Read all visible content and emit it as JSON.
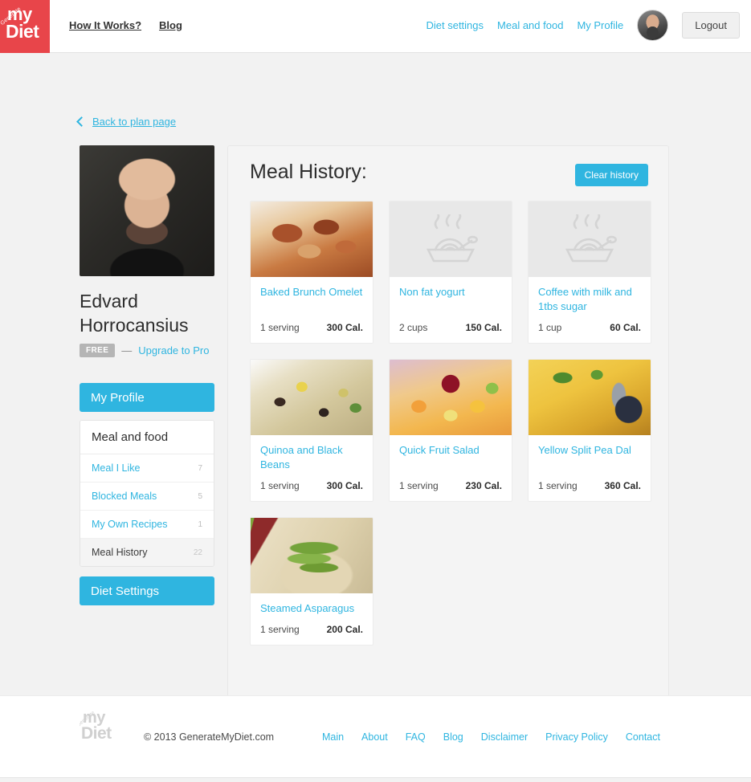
{
  "brand": {
    "logo_my": "my",
    "logo_diet": "Diet",
    "logo_generate": "Generate",
    "accent_blue": "#2fb5e0",
    "logo_red": "#e8454a"
  },
  "header": {
    "nav_left": [
      {
        "label": "How It Works?"
      },
      {
        "label": "Blog"
      }
    ],
    "nav_right": [
      {
        "label": "Diet settings"
      },
      {
        "label": "Meal and food"
      },
      {
        "label": "My Profile"
      }
    ],
    "avatar_icon": "user-avatar-icon",
    "logout_label": "Logout"
  },
  "back_link": {
    "icon": "chevron-left-icon",
    "label": "Back to plan page"
  },
  "sidebar": {
    "photo_icon": "profile-photo",
    "user_name": "Edvard Horrocansius",
    "plan_badge": "FREE",
    "plan_dash": "—",
    "upgrade_label": "Upgrade to Pro",
    "profile_button": "My Profile",
    "menu_heading": "Meal and food",
    "menu_items": [
      {
        "label": "Meal I Like",
        "count": "7",
        "active": false
      },
      {
        "label": "Blocked Meals",
        "count": "5",
        "active": false
      },
      {
        "label": "My Own Recipes",
        "count": "1",
        "active": false
      },
      {
        "label": "Meal History",
        "count": "22",
        "active": true
      }
    ],
    "diet_settings_button": "Diet Settings"
  },
  "main": {
    "title": "Meal History:",
    "clear_button": "Clear history",
    "meals": [
      {
        "name": "Baked Brunch Omelet",
        "serving": "1 serving",
        "calories": "300 Cal.",
        "image": "photo",
        "image_class": "img-omelet"
      },
      {
        "name": "Non fat yogurt",
        "serving": "2 cups",
        "calories": "150 Cal.",
        "image": "placeholder",
        "image_class": "bowl-placeholder"
      },
      {
        "name": "Coffee with milk and 1tbs sugar",
        "serving": "1 cup",
        "calories": "60 Cal.",
        "image": "placeholder",
        "image_class": "bowl-placeholder"
      },
      {
        "name": "Quinoa and Black Beans",
        "serving": "1 serving",
        "calories": "300 Cal.",
        "image": "photo",
        "image_class": "img-quinoa"
      },
      {
        "name": "Quick Fruit Salad",
        "serving": "1 serving",
        "calories": "230 Cal.",
        "image": "photo",
        "image_class": "img-fruit"
      },
      {
        "name": "Yellow Split Pea Dal",
        "serving": "1 serving",
        "calories": "360 Cal.",
        "image": "photo",
        "image_class": "img-dal"
      },
      {
        "name": "Steamed Asparagus",
        "serving": "1 serving",
        "calories": "200 Cal.",
        "image": "photo",
        "image_class": "img-asparagus"
      }
    ]
  },
  "footer": {
    "copyright": "© 2013 GenerateMyDiet.com",
    "links": [
      {
        "label": "Main"
      },
      {
        "label": "About"
      },
      {
        "label": "FAQ"
      },
      {
        "label": "Blog"
      },
      {
        "label": "Disclaimer"
      },
      {
        "label": "Privacy Policy"
      },
      {
        "label": "Contact"
      }
    ]
  }
}
